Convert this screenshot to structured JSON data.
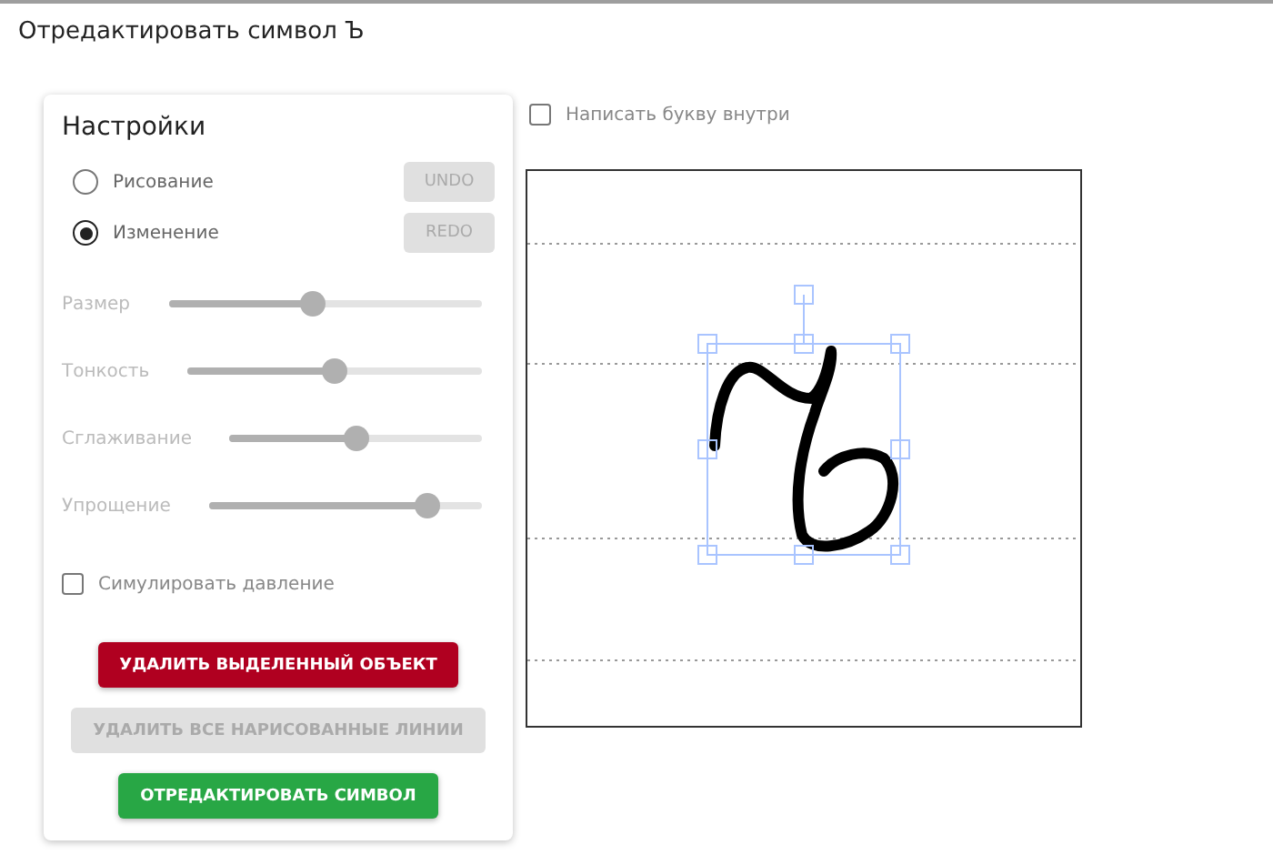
{
  "title": "Отредактировать символ Ъ",
  "settings": {
    "heading": "Настройки",
    "modes": [
      {
        "label": "Рисование",
        "selected": false
      },
      {
        "label": "Изменение",
        "selected": true
      }
    ],
    "history_buttons": [
      {
        "label": "UNDO",
        "disabled": true
      },
      {
        "label": "REDO",
        "disabled": true
      }
    ],
    "sliders": [
      {
        "label": "Размер",
        "level": 0.46
      },
      {
        "label": "Тонкость",
        "level": 0.5
      },
      {
        "label": "Сглаживание",
        "level": 0.5
      },
      {
        "label": "Упрощение",
        "level": 0.8
      }
    ],
    "simulate_pressure": {
      "label": "Симулировать давление",
      "checked": false
    },
    "actions": [
      {
        "label": "УДАЛИТЬ ВЫДЕЛЕННЫЙ ОБЪЕКТ",
        "kind": "danger",
        "disabled": false
      },
      {
        "label": "УДАЛИТЬ ВСЕ НАРИСОВАННЫЕ ЛИНИИ",
        "kind": "neutral",
        "disabled": true
      },
      {
        "label": "ОТРЕДАКТИРОВАТЬ СИМВОЛ",
        "kind": "success",
        "disabled": false
      }
    ]
  },
  "write_inside": {
    "label": "Написать букву внутри",
    "checked": false
  },
  "canvas": {
    "selected": true
  }
}
